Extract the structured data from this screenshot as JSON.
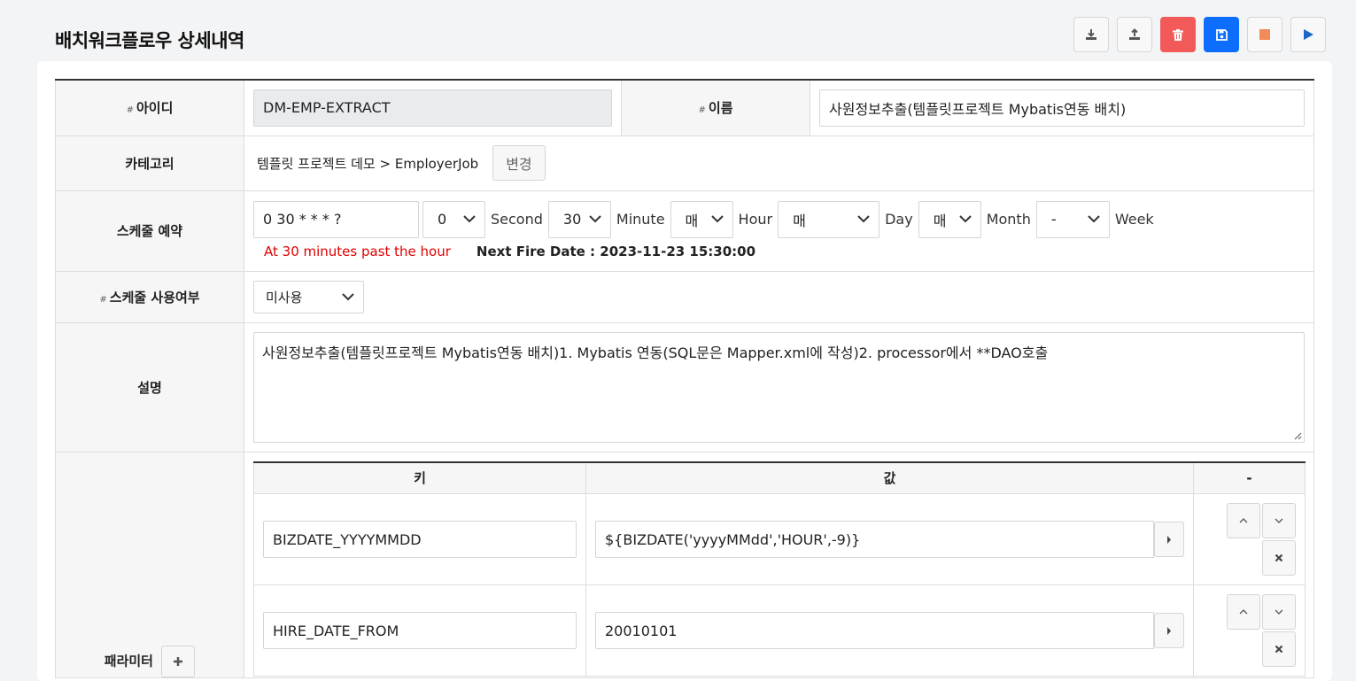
{
  "page": {
    "title": "배치워크플로우 상세내역"
  },
  "toolbar": {
    "buttons": [
      {
        "name": "download-icon"
      },
      {
        "name": "upload-icon"
      },
      {
        "name": "trash-icon"
      },
      {
        "name": "save-icon"
      },
      {
        "name": "stop-icon"
      },
      {
        "name": "play-icon"
      }
    ],
    "colors": {
      "delete": "#f25a5a",
      "save": "#0d6efd",
      "stop": "#f28a5a",
      "play": "#1a66c9"
    }
  },
  "form": {
    "id": {
      "label": "아이디",
      "required_mark": "#",
      "value": "DM-EMP-EXTRACT"
    },
    "name": {
      "label": "이름",
      "required_mark": "#",
      "value": "사원정보추출(템플릿프로젝트 Mybatis연동 배치)"
    },
    "category": {
      "label": "카테고리",
      "value": "템플릿 프로젝트 데모 > EmployerJob",
      "change_button": "변경"
    },
    "schedule": {
      "label": "스케줄 예약",
      "cron": "0 30 * * * ?",
      "second": {
        "value": "0",
        "label": "Second"
      },
      "minute": {
        "value": "30",
        "label": "Minute"
      },
      "hour": {
        "value": "매",
        "label": "Hour"
      },
      "day": {
        "value": "매",
        "label": "Day"
      },
      "month": {
        "value": "매",
        "label": "Month"
      },
      "week": {
        "value": "-",
        "label": "Week"
      },
      "description": "At 30 minutes past the hour",
      "next_fire": "Next Fire Date : 2023-11-23 15:30:00",
      "description_color": "#e00000"
    },
    "schedule_use": {
      "label": "스케줄 사용여부",
      "required_mark": "#",
      "value": "미사용"
    },
    "description": {
      "label": "설명",
      "value": "사원정보추출(템플릿프로젝트 Mybatis연동 배치)1. Mybatis 연동(SQL문은 Mapper.xml에 작성)2. processor에서 **DAO호출"
    },
    "parameters": {
      "label": "패라미터",
      "headers": {
        "key": "키",
        "value": "값",
        "action": "-"
      },
      "rows": [
        {
          "key": "BIZDATE_YYYYMMDD",
          "value": "${BIZDATE('yyyyMMdd','HOUR',-9)}"
        },
        {
          "key": "HIRE_DATE_FROM",
          "value": "20010101"
        }
      ]
    }
  }
}
